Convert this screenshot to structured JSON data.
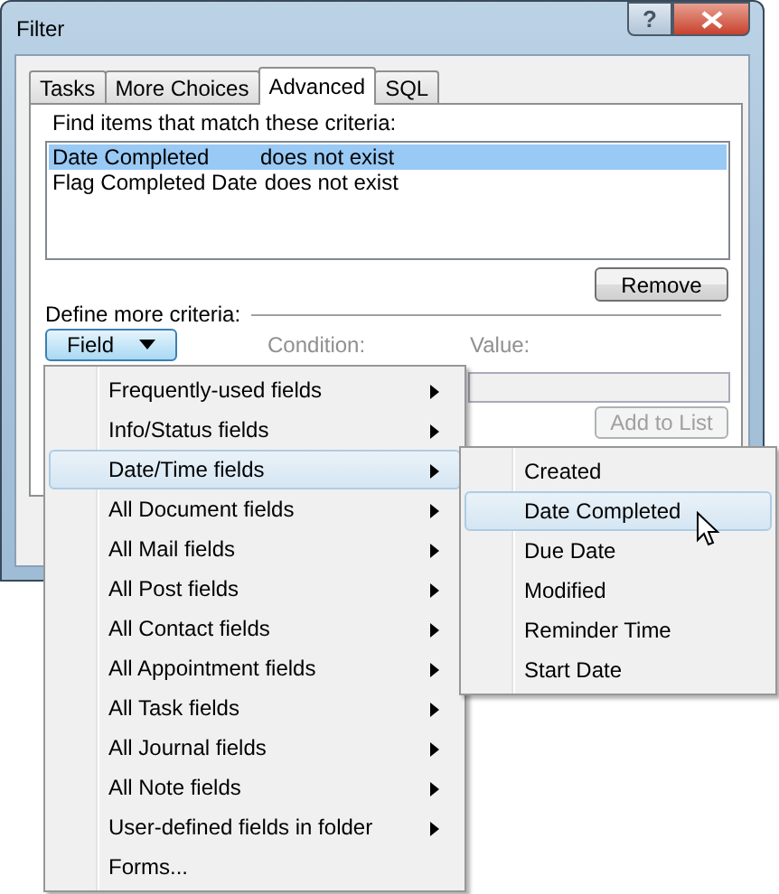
{
  "window": {
    "title": "Filter",
    "help": "?"
  },
  "tabs": [
    {
      "label": "Tasks",
      "selected": false
    },
    {
      "label": "More Choices",
      "selected": false
    },
    {
      "label": "Advanced",
      "selected": true
    },
    {
      "label": "SQL",
      "selected": false
    }
  ],
  "criteria_label": "Find items that match these criteria:",
  "criteria": [
    {
      "field": "Date Completed",
      "condition": "does not exist",
      "selected": true
    },
    {
      "field": "Flag Completed Date",
      "condition": "does not exist",
      "selected": false
    }
  ],
  "remove_button": "Remove",
  "define_label": "Define more criteria:",
  "field_button": "Field",
  "condition_label": "Condition:",
  "value_label": "Value:",
  "add_button": {
    "label": "Add to List",
    "disabled": true
  },
  "menu": [
    {
      "label": "Frequently-used fields",
      "submenu": true,
      "selected": false
    },
    {
      "label": "Info/Status fields",
      "submenu": true,
      "selected": false
    },
    {
      "label": "Date/Time fields",
      "submenu": true,
      "selected": true
    },
    {
      "label": "All Document fields",
      "submenu": true,
      "selected": false
    },
    {
      "label": "All Mail fields",
      "submenu": true,
      "selected": false
    },
    {
      "label": "All Post fields",
      "submenu": true,
      "selected": false
    },
    {
      "label": "All Contact fields",
      "submenu": true,
      "selected": false
    },
    {
      "label": "All Appointment fields",
      "submenu": true,
      "selected": false
    },
    {
      "label": "All Task fields",
      "submenu": true,
      "selected": false
    },
    {
      "label": "All Journal fields",
      "submenu": true,
      "selected": false
    },
    {
      "label": "All Note fields",
      "submenu": true,
      "selected": false
    },
    {
      "label": "User-defined fields in folder",
      "submenu": true,
      "selected": false
    },
    {
      "label": "Forms...",
      "submenu": false,
      "selected": false
    }
  ],
  "submenu": [
    {
      "label": "Created",
      "selected": false
    },
    {
      "label": "Date Completed",
      "selected": true
    },
    {
      "label": "Due Date",
      "selected": false
    },
    {
      "label": "Modified",
      "selected": false
    },
    {
      "label": "Reminder Time",
      "selected": false
    },
    {
      "label": "Start Date",
      "selected": false
    }
  ]
}
